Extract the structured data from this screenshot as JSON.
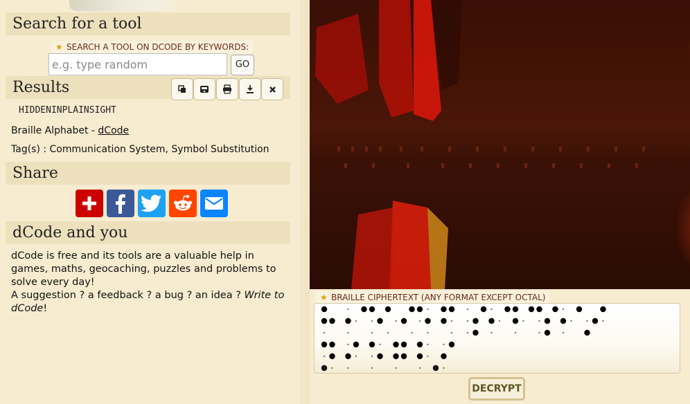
{
  "search": {
    "heading": "Search for a tool",
    "keywords_label": "SEARCH A TOOL ON DCODE BY KEYWORDS:",
    "placeholder": "e.g. type random",
    "value": "",
    "go_label": "GO"
  },
  "results": {
    "heading": "Results",
    "tools": [
      {
        "icon": "copy-icon"
      },
      {
        "icon": "save-icon"
      },
      {
        "icon": "print-icon"
      },
      {
        "icon": "download-icon"
      },
      {
        "icon": "close-icon"
      }
    ],
    "output": "HIDDENINPLAINSIGHT",
    "source_prefix": "Braille Alphabet - ",
    "source_link": "dCode",
    "tags": "Tag(s) : Communication System, Symbol Substitution"
  },
  "share": {
    "heading": "Share",
    "buttons": [
      {
        "icon": "add-icon",
        "color": "#cc0000"
      },
      {
        "icon": "facebook-icon",
        "color": "#3b5998"
      },
      {
        "icon": "twitter-icon",
        "color": "#1da1f2"
      },
      {
        "icon": "reddit-icon",
        "color": "#ff4500"
      },
      {
        "icon": "email-icon",
        "color": "#0a84ff"
      }
    ]
  },
  "about": {
    "heading": "dCode and you",
    "line1": "dCode is free and its tools are a valuable help in games, maths, geocaching, puzzles and problems to solve every day!",
    "line2_prefix": "A suggestion ? a feedback ? a bug ? an idea ? ",
    "line2_link": "Write to dCode",
    "line2_suffix": "!"
  },
  "cipher": {
    "label": "BRAILLE CIPHERTEXT (ANY FORMAT EXCEPT OCTAL)",
    "rows": [
      "●  · ●● ●  ●●· ●● · ●· ●● ●● ●· ●  ●",
      "●● ●· ·● ·● ·● ●· ·● ●· ●· ·● ●· ·●·",
      "·  ·  · ·  · ·  · ·● ·  ·  ·● ·  ●",
      "●● ·● ●· ●● ●· ·●",
      "·● ●· ·● ●● ●· ●",
      "●· ·  ·  ·  · ●·"
    ],
    "decrypt_label": "DECRYPT"
  },
  "colors": {
    "page_bg": "#f7ecd0",
    "section_header_bg": "#ede0bd",
    "label_text": "#6b2a12",
    "star": "#d9a300"
  }
}
